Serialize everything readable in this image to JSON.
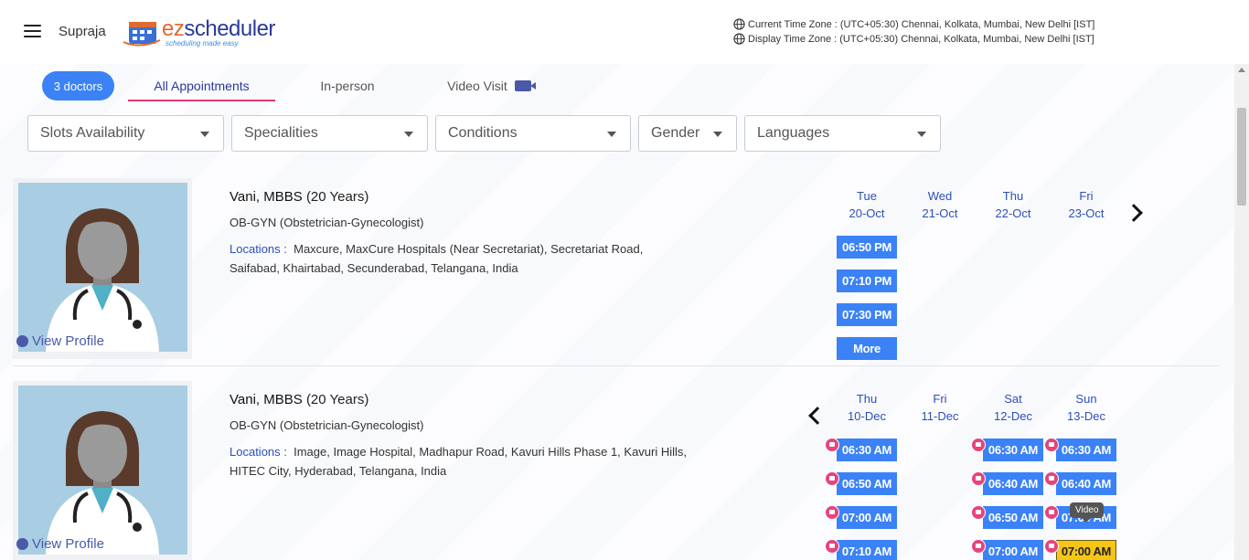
{
  "header": {
    "user_name": "Supraja",
    "logo_main": "ez",
    "logo_rest": "scheduler",
    "logo_tagline": "scheduling made easy",
    "current_tz": "Current Time Zone : (UTC+05:30) Chennai, Kolkata, Mumbai, New Delhi [IST]",
    "display_tz": "Display Time Zone : (UTC+05:30) Chennai, Kolkata, Mumbai, New Delhi [IST]"
  },
  "tabs": {
    "doctors_count": "3 doctors",
    "all": "All Appointments",
    "in_person": "In-person",
    "video": "Video Visit"
  },
  "filters": {
    "slots": "Slots Availability",
    "specialities": "Specialities",
    "conditions": "Conditions",
    "gender": "Gender",
    "languages": "Languages"
  },
  "doctors": [
    {
      "name": "Vani, MBBS",
      "experience": "(20 Years)",
      "specialty": "OB-GYN (Obstetrician-Gynecologist)",
      "locations_label": "Locations :",
      "locations": "Maxcure, MaxCure Hospitals (Near Secretariat), Secretariat Road, Saifabad, Khairtabad, Secunderabad, Telangana, India",
      "view_profile": "View Profile",
      "days": [
        {
          "dow": "Tue",
          "date": "20-Oct"
        },
        {
          "dow": "Wed",
          "date": "21-Oct"
        },
        {
          "dow": "Thu",
          "date": "22-Oct"
        },
        {
          "dow": "Fri",
          "date": "23-Oct"
        }
      ],
      "slots": [
        "06:50 PM",
        "07:10 PM",
        "07:30 PM"
      ],
      "more": "More"
    },
    {
      "name": "Vani, MBBS",
      "experience": "(20 Years)",
      "specialty": "OB-GYN (Obstetrician-Gynecologist)",
      "locations_label": "Locations :",
      "locations": "Image, Image Hospital, Madhapur Road, Kavuri Hills Phase 1, Kavuri Hills, HITEC City, Hyderabad, Telangana, India",
      "view_profile": "View Profile",
      "days": [
        {
          "dow": "Thu",
          "date": "10-Dec"
        },
        {
          "dow": "Fri",
          "date": "11-Dec"
        },
        {
          "dow": "Sat",
          "date": "12-Dec"
        },
        {
          "dow": "Sun",
          "date": "13-Dec"
        }
      ],
      "slots_thu": [
        "06:30 AM",
        "06:50 AM",
        "07:00 AM",
        "07:10 AM"
      ],
      "slots_sat": [
        "06:30 AM",
        "06:40 AM",
        "06:50 AM",
        "07:00 AM"
      ],
      "slots_sun": [
        "06:30 AM",
        "06:40 AM",
        "07:00 AM",
        "07:00 AM"
      ],
      "tooltip": "Video"
    }
  ],
  "colors": {
    "accent": "#3b82f6",
    "brand": "#2a3a9a",
    "tab_underline": "#e23d74",
    "video_badge": "#e6457a",
    "selected_slot": "#f5c518"
  }
}
